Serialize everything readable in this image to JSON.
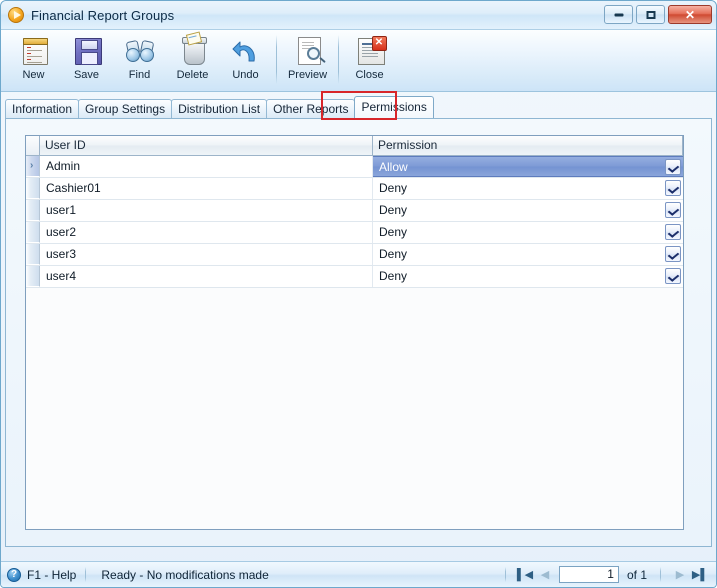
{
  "window": {
    "title": "Financial Report Groups",
    "icon": "play-circle-icon",
    "controls": {
      "minimize": "minimize-button",
      "maximize": "maximize-button",
      "close": "✕"
    }
  },
  "toolbar": {
    "items": [
      {
        "label": "New",
        "icon": "new-document-icon"
      },
      {
        "label": "Save",
        "icon": "floppy-disk-icon"
      },
      {
        "label": "Find",
        "icon": "binoculars-icon"
      },
      {
        "label": "Delete",
        "icon": "trash-bin-icon"
      },
      {
        "label": "Undo",
        "icon": "undo-arrow-icon"
      },
      {
        "label": "Preview",
        "icon": "page-magnifier-icon"
      },
      {
        "label": "Close",
        "icon": "document-close-icon"
      }
    ]
  },
  "tabs": [
    {
      "label": "Information",
      "active": false
    },
    {
      "label": "Group Settings",
      "active": false
    },
    {
      "label": "Distribution List",
      "active": false
    },
    {
      "label": "Other Reports",
      "active": false
    },
    {
      "label": "Permissions",
      "active": true
    }
  ],
  "grid": {
    "columns": [
      "User ID",
      "Permission"
    ],
    "rows": [
      {
        "user_id": "Admin",
        "permission": "Allow",
        "selected": true,
        "row_marker": "›"
      },
      {
        "user_id": "Cashier01",
        "permission": "Deny",
        "selected": false,
        "row_marker": ""
      },
      {
        "user_id": "user1",
        "permission": "Deny",
        "selected": false,
        "row_marker": ""
      },
      {
        "user_id": "user2",
        "permission": "Deny",
        "selected": false,
        "row_marker": ""
      },
      {
        "user_id": "user3",
        "permission": "Deny",
        "selected": false,
        "row_marker": ""
      },
      {
        "user_id": "user4",
        "permission": "Deny",
        "selected": false,
        "row_marker": ""
      }
    ],
    "permission_options": [
      "Allow",
      "Deny"
    ]
  },
  "statusbar": {
    "help_icon": "?",
    "help_label": "F1 - Help",
    "status_text": "Ready - No modifications made",
    "nav": {
      "first": "▌◀",
      "previous": "◀",
      "page_value": "1",
      "of_label": "of 1",
      "next": "▶",
      "last": "▶▌"
    }
  },
  "annotation": {
    "highlight_target": "Permissions",
    "highlight_color": "#d8262a"
  }
}
